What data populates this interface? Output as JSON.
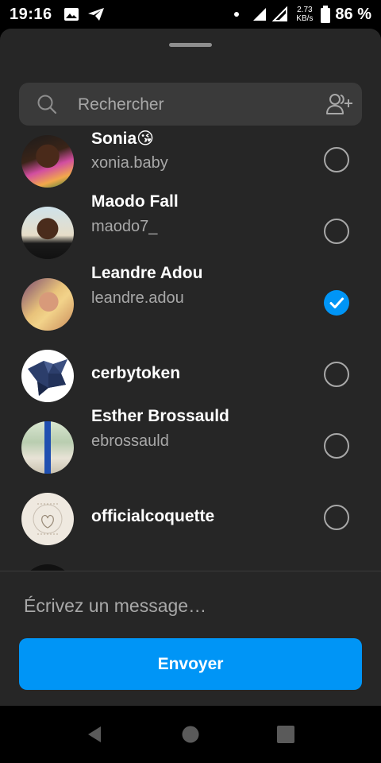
{
  "status_bar": {
    "time": "19:16",
    "net_speed_value": "2.73",
    "net_speed_unit": "KB/s",
    "battery": "86 %"
  },
  "search": {
    "placeholder": "Rechercher"
  },
  "contacts": [
    {
      "name": "Sonia😘",
      "username": "xonia.baby",
      "selected": false
    },
    {
      "name": "Maodo Fall",
      "username": "maodo7_",
      "selected": false
    },
    {
      "name": "Leandre Adou",
      "username": "leandre.adou",
      "selected": true
    },
    {
      "name": "cerbytoken",
      "username": "",
      "selected": false
    },
    {
      "name": "Esther Brossauld",
      "username": "ebrossauld",
      "selected": false
    },
    {
      "name": "officialcoquette",
      "username": "",
      "selected": false
    }
  ],
  "composer": {
    "placeholder": "Écrivez un message…",
    "send_label": "Envoyer"
  },
  "colors": {
    "accent": "#0095f6",
    "sheet_background": "#262626",
    "secondary_text": "#a8a8a8"
  }
}
